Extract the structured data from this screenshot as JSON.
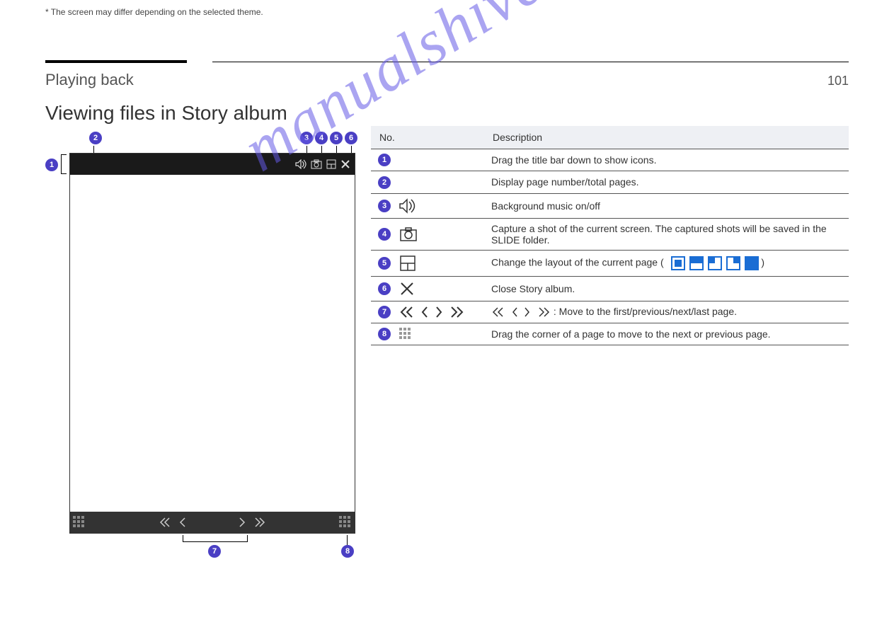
{
  "header": {
    "section_title": "Playing back",
    "page_number": "101"
  },
  "subtitle": "Viewing files in Story album",
  "table": {
    "col_headers": [
      "No.",
      "Description"
    ],
    "rows": [
      {
        "num": "1",
        "icon": null,
        "desc": "Drag the title bar down to show icons."
      },
      {
        "num": "2",
        "icon": null,
        "desc": "Display page number/total pages."
      },
      {
        "num": "3",
        "icon": "speaker",
        "desc": "Background music on/off"
      },
      {
        "num": "4",
        "icon": "camera",
        "desc": "Capture a shot of the current screen. The captured shots will be saved in the SLIDE folder."
      },
      {
        "num": "5",
        "icon": "layout",
        "desc_prefix": "Change the layout of the current page (",
        "desc_suffix": ")"
      },
      {
        "num": "6",
        "icon": "close",
        "desc": "Close Story album."
      },
      {
        "num": "7",
        "icon": "nav",
        "desc": ": Move to the first/previous/next/last page."
      },
      {
        "num": "8",
        "icon": "grid",
        "desc": "Drag the corner of a page to move to the next or previous page."
      }
    ]
  },
  "footnote": "* The screen may differ depending on the selected theme.",
  "watermark": "manualshive.com"
}
